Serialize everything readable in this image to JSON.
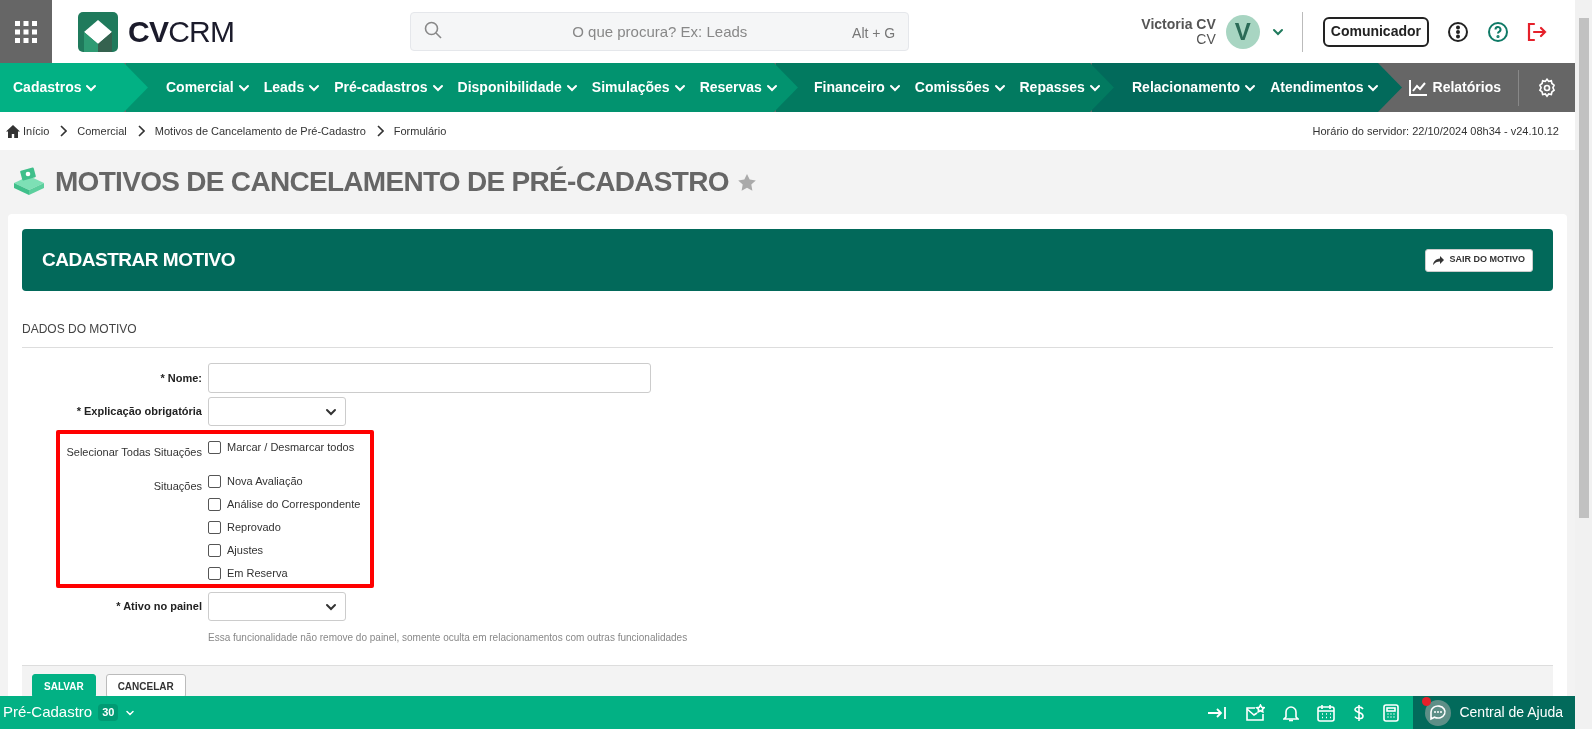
{
  "logo": {
    "text": "**CV**CRM"
  },
  "search": {
    "placeholder": "O que procura? Ex: Leads",
    "shortcut": "Alt + G"
  },
  "user": {
    "name": "Victoria CV",
    "subtitle": "CV",
    "initial": "V"
  },
  "header_button": "Comunicador",
  "nav": {
    "groups": [
      {
        "items": [
          {
            "label": "Cadastros",
            "dropdown": true
          }
        ]
      },
      {
        "items": [
          {
            "label": "Comercial",
            "dropdown": true
          },
          {
            "label": "Leads",
            "dropdown": true
          },
          {
            "label": "Pré-cadastros",
            "dropdown": true
          },
          {
            "label": "Disponibilidade",
            "dropdown": true
          },
          {
            "label": "Simulações",
            "dropdown": true
          },
          {
            "label": "Reservas",
            "dropdown": true
          }
        ]
      },
      {
        "items": [
          {
            "label": "Financeiro",
            "dropdown": true
          },
          {
            "label": "Comissões",
            "dropdown": true
          },
          {
            "label": "Repasses",
            "dropdown": true
          }
        ]
      },
      {
        "items": [
          {
            "label": "Relacionamento",
            "dropdown": true
          },
          {
            "label": "Atendimentos",
            "dropdown": true
          }
        ]
      }
    ],
    "reports": "Relatórios"
  },
  "breadcrumb": [
    "Início",
    "Comercial",
    "Motivos de Cancelamento de Pré-Cadastro",
    "Formulário"
  ],
  "server_time": "Horário do servidor: 22/10/2024 08h34 - v24.10.12",
  "page_title": "MOTIVOS DE CANCELAMENTO DE PRÉ-CADASTRO",
  "favorite": false,
  "form": {
    "title": "CADASTRAR MOTIVO",
    "exit_button": "SAIR DO MOTIVO",
    "section": "DADOS DO MOTIVO",
    "fields": [
      {
        "kind": "text",
        "label": "* Nome:",
        "highlighted": false
      },
      {
        "kind": "select",
        "label": "* Explicação obrigatória",
        "highlighted": false
      },
      {
        "kind": "checkboxes",
        "label": "Selecionar Todas Situações",
        "highlighted": true,
        "options": [
          {
            "label": "Marcar / Desmarcar todos",
            "checked": false
          }
        ]
      },
      {
        "kind": "checkboxes",
        "label": "Situações",
        "highlighted": true,
        "options": [
          {
            "label": "Nova Avaliação",
            "checked": false
          },
          {
            "label": "Análise do Correspondente",
            "checked": false
          },
          {
            "label": "Reprovado",
            "checked": false
          },
          {
            "label": "Ajustes",
            "checked": false
          },
          {
            "label": "Em Reserva",
            "checked": false
          }
        ]
      },
      {
        "kind": "select",
        "label": "* Ativo no painel",
        "highlighted": false,
        "help": "Essa funcionalidade não remove do painel, somente oculta em relacionamentos com outras funcionalidades"
      }
    ],
    "buttons": [
      {
        "label": "SALVAR",
        "kind": "primary"
      },
      {
        "label": "CANCELAR",
        "kind": "secondary"
      }
    ]
  },
  "footer": {
    "module": "Pré-Cadastro",
    "count": "30",
    "help": "Central de Ajuda",
    "help_notification": true
  }
}
